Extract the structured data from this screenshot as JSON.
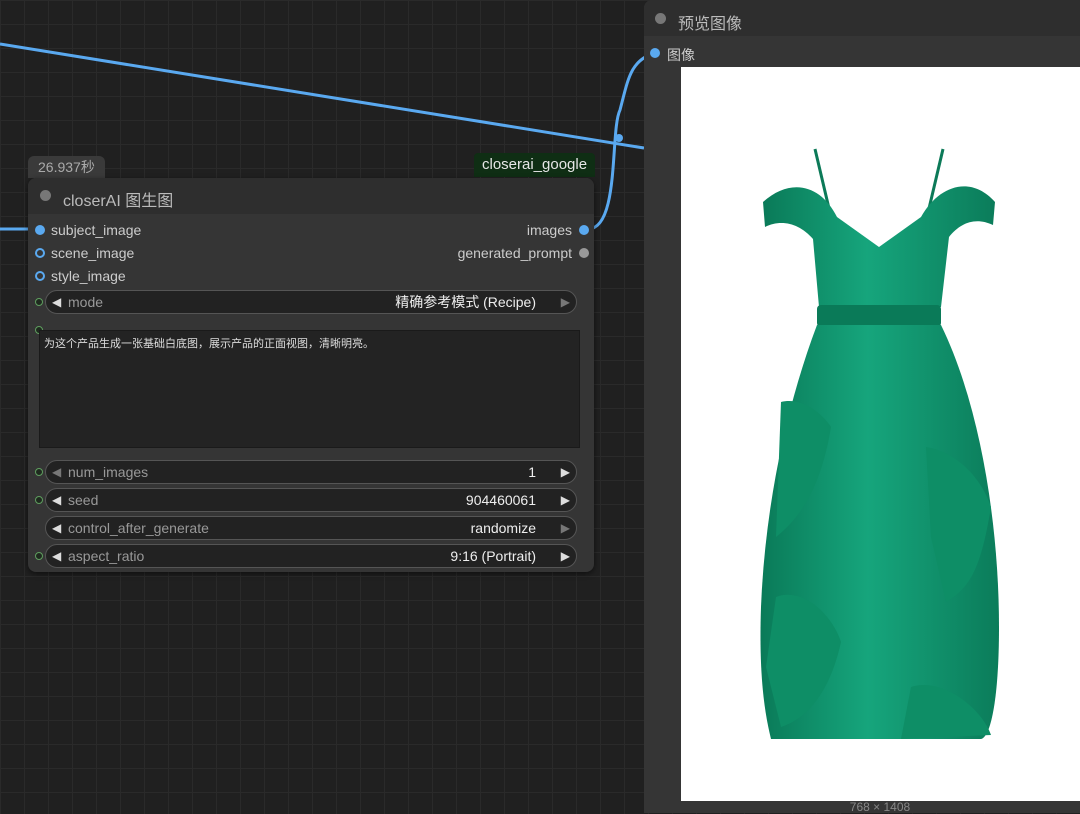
{
  "node": {
    "duration": "26.937秒",
    "provider": "closerai_google",
    "title": "closerAI 图生图",
    "inputs": [
      "subject_image",
      "scene_image",
      "style_image"
    ],
    "outputs": [
      "images",
      "generated_prompt"
    ],
    "widgets": {
      "mode": {
        "label": "mode",
        "value": "精确参考模式 (Recipe)"
      },
      "prompt": "为这个产品生成一张基础白底图，展示产品的正面视图，清晰明亮。",
      "num_images": {
        "label": "num_images",
        "value": "1"
      },
      "seed": {
        "label": "seed",
        "value": "904460061"
      },
      "control_after_generate": {
        "label": "control_after_generate",
        "value": "randomize"
      },
      "aspect_ratio": {
        "label": "aspect_ratio",
        "value": "9:16 (Portrait)"
      }
    }
  },
  "preview": {
    "title": "预览图像",
    "input_label": "图像",
    "image_dimensions": "768 × 1408",
    "image_subject": "green-tulle-dress"
  },
  "colors": {
    "link_blue": "#5aa9f0",
    "provider_badge_bg": "#0f2e14",
    "dress_green": "#0f8f6a"
  }
}
